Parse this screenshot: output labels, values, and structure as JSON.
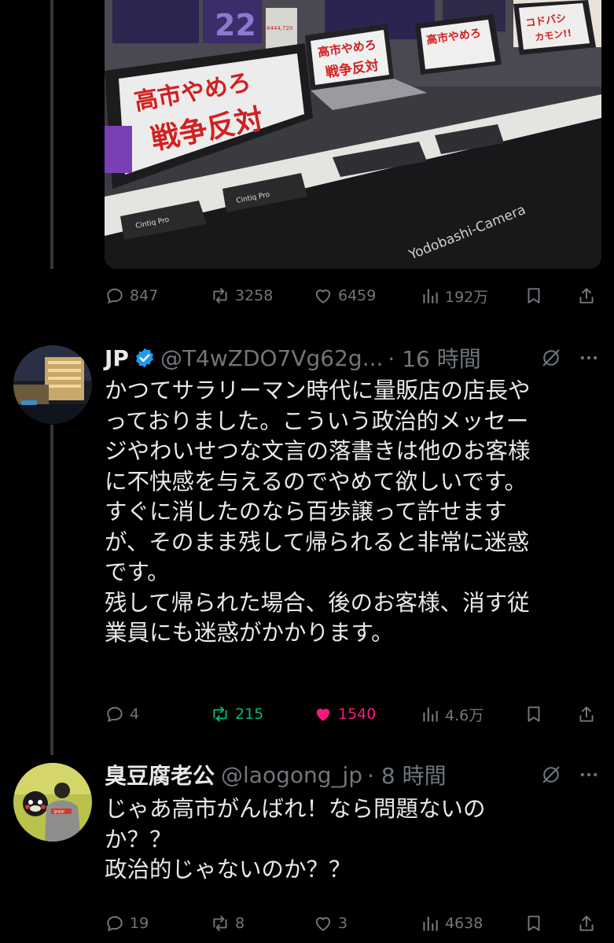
{
  "post1": {
    "media": {
      "sign_left_line1": "高市やめろ",
      "sign_left_line2": "戦争反対",
      "sign_mid_line1": "高市やめろ",
      "sign_mid_line2": "戦争反対",
      "sign_right_line1": "高市やめろ",
      "sign_right_line2": "コドバシ",
      "sign_right_line3": "カモン!!",
      "price_tag": "¥444,720",
      "sign_22": "22",
      "tablet_brand_1": "Cintiq Pro",
      "tablet_brand_2": "Cintiq Pro",
      "store_banner": "Yodobashi-Camera"
    },
    "actions": {
      "replies": "847",
      "reposts": "3258",
      "likes": "6459",
      "views": "192万"
    }
  },
  "post2": {
    "name": "JP",
    "handle": "@T4wZDO7Vg62g...",
    "time": "· 16 時間",
    "text": "かつてサラリーマン時代に量販店の店長や\nっておりました。こういう政治的メッセー\nジやわいせつな文言の落書きは他のお客様\nに不快感を与えるのでやめて欲しいです。\nすぐに消したのなら百歩譲って許せます\nが、そのまま残して帰られると非常に迷惑\nです。\n残して帰られた場合、後のお客様、消す従\n業員にも迷惑がかかります。",
    "actions": {
      "replies": "4",
      "reposts": "215",
      "likes": "1540",
      "views": "4.6万"
    }
  },
  "post3": {
    "name": "臭豆腐老公",
    "handle": "@laogong_jp",
    "time": "· 8 時間",
    "text": "じゃあ高市がんばれ！なら問題ないの\nか？？\n政治的じゃないのか？？",
    "avatar_shirt_text": "SHOP",
    "actions": {
      "replies": "19",
      "reposts": "8",
      "likes": "3",
      "views": "4638"
    }
  },
  "colors": {
    "background": "#000000",
    "text": "#e7e9ea",
    "muted": "#71767b",
    "verified": "#1d9bf0",
    "repost_active": "#00ba7c",
    "like_active": "#f91880"
  }
}
